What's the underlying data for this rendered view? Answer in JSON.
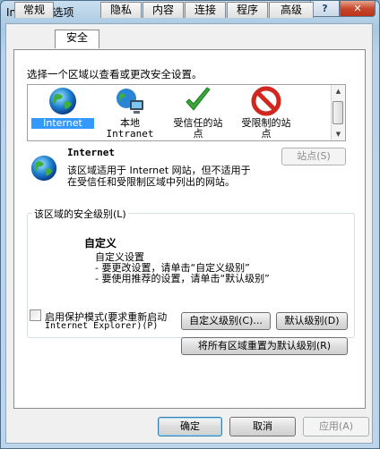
{
  "window": {
    "title": "Internet 选项",
    "help_label": "?",
    "close_label": "✕"
  },
  "tabs": [
    {
      "label": "常规",
      "active": false
    },
    {
      "label": "安全",
      "active": true
    },
    {
      "label": "隐私",
      "active": false
    },
    {
      "label": "内容",
      "active": false
    },
    {
      "label": "连接",
      "active": false
    },
    {
      "label": "程序",
      "active": false
    },
    {
      "label": "高级",
      "active": false
    }
  ],
  "security": {
    "prompt": "选择一个区域以查看或更改安全设置。",
    "zones": [
      {
        "line1": "Internet",
        "line2": "",
        "icon": "globe-icon",
        "selected": true
      },
      {
        "line1": "本地",
        "line2": "Intranet",
        "icon": "intranet-icon",
        "selected": false
      },
      {
        "line1": "受信任的站",
        "line2": "点",
        "icon": "checkmark-icon",
        "selected": false
      },
      {
        "line1": "受限制的站",
        "line2": "点",
        "icon": "restricted-icon",
        "selected": false
      }
    ],
    "zone_info": {
      "name": "Internet",
      "desc_line1": "该区域适用于 Internet 网站，但不适用于",
      "desc_line2": "在受信任和受限制区域中列出的网站。",
      "sites_button": "站点(S)"
    },
    "level_group": {
      "legend": "该区域的安全级别(L)",
      "level_name": "自定义",
      "line1": "自定义设置",
      "line2": "- 要更改设置，请单击“自定义级别”",
      "line3": "- 要使用推荐的设置，请单击“默认级别”"
    },
    "protected_mode": {
      "label_line1": "启用保护模式(要求重新启动",
      "label_line2": "Internet Explorer)(P)",
      "checked": false
    },
    "custom_level_button": "自定义级别(C)...",
    "default_level_button": "默认级别(D)",
    "reset_all_button": "将所有区域重置为默认级别(R)"
  },
  "footer": {
    "ok": "确定",
    "cancel": "取消",
    "apply": "应用(A)"
  }
}
